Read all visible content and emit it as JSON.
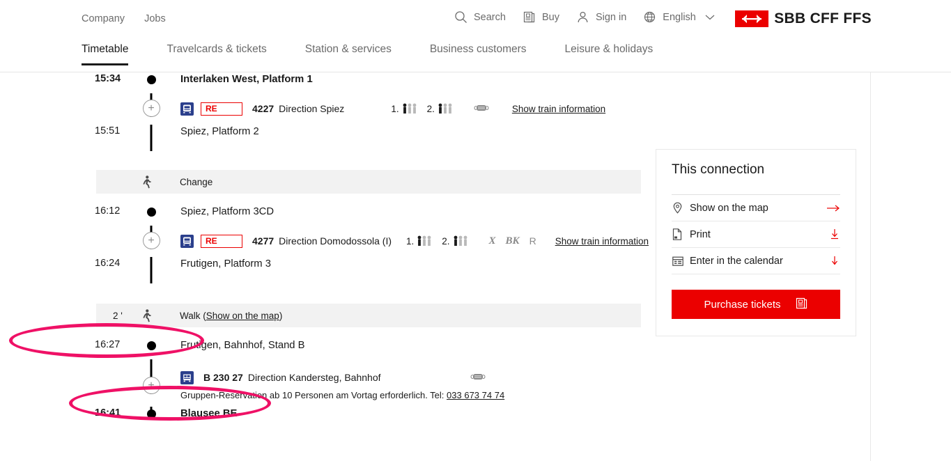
{
  "header": {
    "meta_links": [
      {
        "label": "Company"
      },
      {
        "label": "Jobs"
      }
    ],
    "meta_actions": [
      {
        "label": "Search",
        "icon": "search-icon"
      },
      {
        "label": "Buy",
        "icon": "ticket-icon"
      },
      {
        "label": "Sign in",
        "icon": "user-icon"
      },
      {
        "label": "English",
        "icon": "globe-icon"
      }
    ],
    "logo_text": "SBB CFF FFS",
    "nav": [
      {
        "label": "Timetable",
        "active": true
      },
      {
        "label": "Travelcards & tickets",
        "active": false
      },
      {
        "label": "Station & services",
        "active": false
      },
      {
        "label": "Business customers",
        "active": false
      },
      {
        "label": "Leisure & holidays",
        "active": false
      }
    ]
  },
  "journey": {
    "leg1": {
      "departure_time": "15:34",
      "departure_stop": "Interlaken West, Platform 1",
      "line_badge": "RE",
      "train_no": "4227",
      "direction": "Direction Spiez",
      "class1_label": "1.",
      "class2_label": "2.",
      "train_info_link": "Show train information",
      "arrival_time": "15:51",
      "arrival_stop": "Spiez, Platform 2"
    },
    "change1": {
      "label": "Change"
    },
    "leg2": {
      "departure_time": "16:12",
      "departure_stop": "Spiez, Platform 3CD",
      "line_badge": "RE",
      "train_no": "4277",
      "direction": "Direction Domodossola (I)",
      "class1_label": "1.",
      "class2_label": "2.",
      "service_x": "X",
      "service_bk": "BK",
      "service_r": "R",
      "train_info_link": "Show train information",
      "arrival_time": "16:24",
      "arrival_stop": "Frutigen, Platform 3"
    },
    "walk": {
      "duration": "2 '",
      "label": "Walk (",
      "map_link": "Show on the map",
      "label_end": ")"
    },
    "leg3": {
      "departure_time": "16:27",
      "departure_stop": "Frutigen, Bahnhof, Stand B",
      "line_no": "B 230 27",
      "direction": "Direction Kandersteg, Bahnhof",
      "note": "Gruppen-Reservation ab 10 Personen am Vortag erforderlich. Tel:",
      "note_phone": "033 673 74 74",
      "arrival_time": "16:41",
      "arrival_stop": "Blausee BE"
    }
  },
  "sidebar": {
    "title": "This connection",
    "items": [
      {
        "label": "Show on the map",
        "icon": "map-pin-icon",
        "action": "arrow-right-icon"
      },
      {
        "label": "Print",
        "icon": "document-icon",
        "action": "download-icon"
      },
      {
        "label": "Enter in the calendar",
        "icon": "calendar-icon",
        "action": "arrow-down-icon"
      }
    ],
    "purchase_button": "Purchase tickets"
  },
  "colors": {
    "brand_red": "#eb0000",
    "annotation_pink": "#ef1166",
    "strip_gray": "#f2f2f2"
  }
}
